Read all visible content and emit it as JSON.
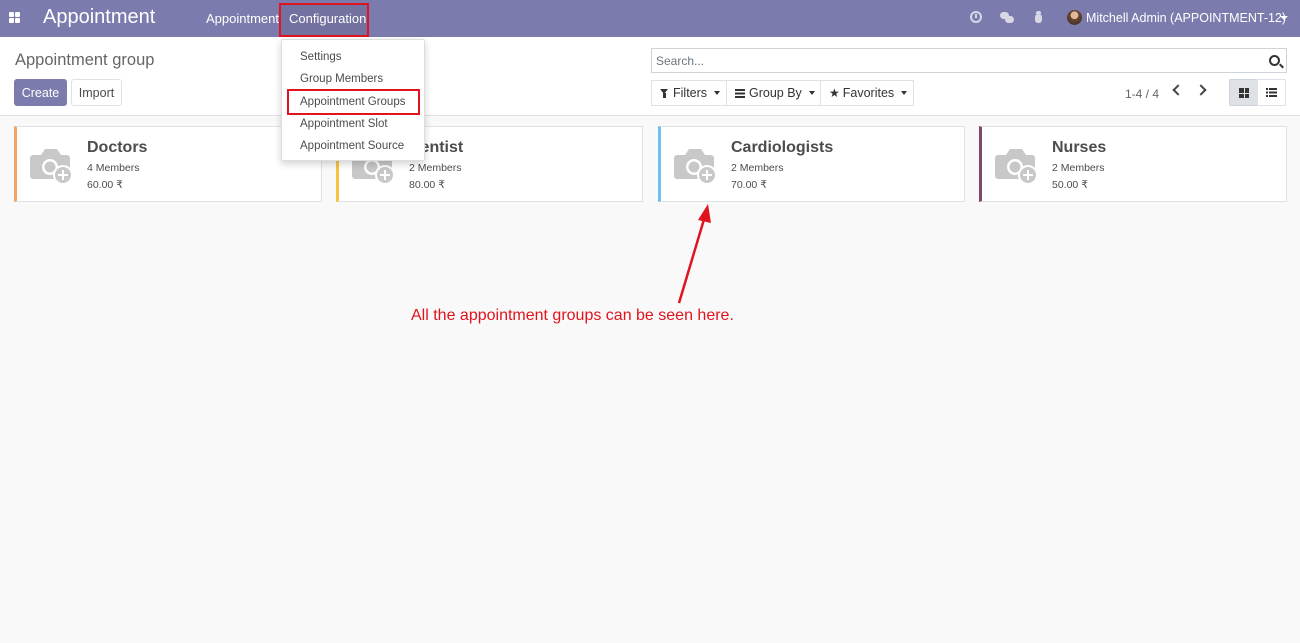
{
  "navbar": {
    "brand": "Appointment",
    "menus": [
      {
        "label": "Appointment"
      },
      {
        "label": "Configuration"
      }
    ],
    "user": "Mitchell Admin (APPOINTMENT-12)",
    "icons": [
      "apps-icon",
      "clock-icon",
      "chat-icon",
      "bug-icon",
      "avatar"
    ]
  },
  "control_panel": {
    "breadcrumb": "Appointment group",
    "create_label": "Create",
    "import_label": "Import",
    "search_placeholder": "Search...",
    "filters_label": "Filters",
    "groupby_label": "Group By",
    "favorites_label": "Favorites",
    "pager": "1-4 / 4",
    "active_view": "kanban"
  },
  "dropdown": {
    "items": [
      {
        "label": "Settings"
      },
      {
        "label": "Group Members"
      },
      {
        "label": "Appointment Groups",
        "highlighted": true
      },
      {
        "label": "Appointment Slot"
      },
      {
        "label": "Appointment Source"
      }
    ]
  },
  "cards": [
    {
      "title": "Doctors",
      "members": "4 Members",
      "price": "60.00 ₹",
      "color": "#f4a460"
    },
    {
      "title": "Dentist",
      "members": "2 Members",
      "price": "80.00 ₹",
      "color": "#f4c542"
    },
    {
      "title": "Cardiologists",
      "members": "2 Members",
      "price": "70.00 ₹",
      "color": "#6cc1ed"
    },
    {
      "title": "Nurses",
      "members": "2 Members",
      "price": "50.00 ₹",
      "color": "#814968"
    }
  ],
  "annotation": {
    "text": "All the appointment groups can be seen here.",
    "color": "#e0141e"
  },
  "colors": {
    "navbar": "#7c7bad",
    "primary": "#7c7bad",
    "highlight_border": "#e0141e"
  }
}
